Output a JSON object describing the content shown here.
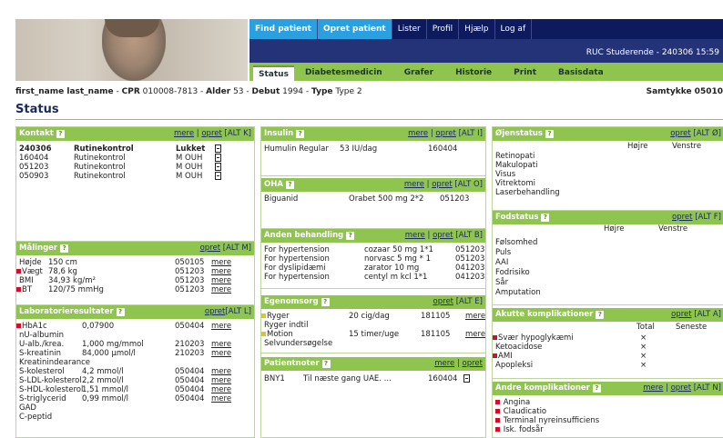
{
  "nav": {
    "find": "Find patient",
    "opret": "Opret patient",
    "lister": "Lister",
    "profil": "Profil",
    "hjaelp": "Hjælp",
    "logaf": "Log af"
  },
  "user": "RUC Studerende - 240306 15:59",
  "tabs": [
    "Status",
    "Diabetesmedicin",
    "Grafer",
    "Historie",
    "Print",
    "Basisdata"
  ],
  "patient": {
    "prefix": "first_name last_name",
    "cpr_label": "CPR",
    "cpr": "010008-7813",
    "alder_label": "Alder",
    "alder": "53",
    "debut_label": "Debut",
    "debut": "1994",
    "type_label": "Type",
    "type": "Type 2",
    "samtykke": "Samtykke 05010"
  },
  "page_title": "Status",
  "common": {
    "help": "?",
    "mere": "mere",
    "opret": "opret"
  },
  "kontakt": {
    "title": "Kontakt",
    "keys": "[ALT K]",
    "rows": [
      [
        "240306",
        "Rutinekontrol",
        "Lukket"
      ],
      [
        "160404",
        "Rutinekontrol",
        "M OUH"
      ],
      [
        "051203",
        "Rutinekontrol",
        "M OUH"
      ],
      [
        "050903",
        "Rutinekontrol",
        "M OUH"
      ]
    ]
  },
  "malinger": {
    "title": "Målinger",
    "keys": "[ALT M]",
    "rows": [
      [
        "Højde",
        "150 cm",
        "050105",
        ""
      ],
      [
        "Vægt",
        "78,6 kg",
        "051203",
        "red"
      ],
      [
        "BMI",
        "34,93 kg/m²",
        "051203",
        ""
      ],
      [
        "BT",
        "120/75 mmHg",
        "051203",
        "red"
      ]
    ]
  },
  "lab": {
    "title": "Laboratorieresultater",
    "keys": "[ALT L]",
    "rows": [
      [
        "HbA1c",
        "0,07900",
        "050404",
        "red"
      ],
      [
        "nU-albumin",
        "",
        "",
        ""
      ],
      [
        "U-alb./krea.",
        "1,000 mg/mmol",
        "210203",
        ""
      ],
      [
        "S-kreatinin",
        "84,000 µmol/l",
        "210203",
        ""
      ],
      [
        "Kreatinindearance",
        "",
        "",
        ""
      ],
      [
        "S-kolesterol",
        "4,2 mmol/l",
        "050404",
        ""
      ],
      [
        "S-LDL-kolesterol",
        "2,2 mmol/l",
        "050404",
        ""
      ],
      [
        "S-HDL-kolesterol",
        "1,51 mmol/l",
        "050404",
        ""
      ],
      [
        "S-triglycerid",
        "0,99 mmol/l",
        "050404",
        ""
      ],
      [
        "GAD",
        "",
        "",
        ""
      ],
      [
        "C-peptid",
        "",
        "",
        ""
      ]
    ]
  },
  "insulin": {
    "title": "Insulin",
    "keys": "[ALT I]",
    "rows": [
      [
        "Humulin Regular",
        "53 IU/dag",
        "160404"
      ]
    ]
  },
  "oha": {
    "title": "OHA",
    "keys": "[ALT O]",
    "rows": [
      [
        "Biguanid",
        "Orabet 500 mg 2*2",
        "051203"
      ]
    ]
  },
  "anden": {
    "title": "Anden behandling",
    "keys": "[ALT B]",
    "rows": [
      [
        "For hypertension",
        "cozaar 50 mg 1*1",
        "051203"
      ],
      [
        "For hypertension",
        "norvasc 5 mg * 1",
        "051203"
      ],
      [
        "For dyslipidæmi",
        "zarator 10 mg",
        "041203"
      ],
      [
        "For hypertension",
        "centyl m kcl 1*1",
        "041203"
      ]
    ]
  },
  "egen": {
    "title": "Egenomsorg",
    "keys": "[ALT E]",
    "rows": [
      [
        "Ryger",
        "20 cig/dag",
        "181105",
        "yel"
      ],
      [
        "Ryger indtil",
        "",
        "",
        ""
      ],
      [
        "Motion",
        "15 timer/uge",
        "181105",
        "yel"
      ],
      [
        "Selvundersøgelse",
        "",
        "",
        ""
      ]
    ]
  },
  "noter": {
    "title": "Patientnoter",
    "rows": [
      [
        "BNY1",
        "Til næste gang UAE. ...",
        "160404"
      ]
    ]
  },
  "ojen": {
    "title": "Øjenstatus",
    "keys": "[ALT Ø]",
    "hojre": "Højre",
    "venstre": "Venstre",
    "rows": [
      "Retinopati",
      "Makulopati",
      "Visus",
      "Vitrektomi",
      "Laserbehandling"
    ]
  },
  "fod": {
    "title": "Fodstatus",
    "keys": "[ALT F]",
    "hojre": "Højre",
    "venstre": "Venstre",
    "rows": [
      "Følsomhed",
      "Puls",
      "AAI",
      "Fodrisiko",
      "Sår",
      "Amputation"
    ]
  },
  "akutte": {
    "title": "Akutte komplikationer",
    "keys": "[ALT A]",
    "total": "Total",
    "seneste": "Seneste",
    "rows": [
      [
        "Svær hypoglykæmi",
        "×",
        "red"
      ],
      [
        "Ketoacidose",
        "×",
        ""
      ],
      [
        "AMI",
        "×",
        "red"
      ],
      [
        "Apopleksi",
        "×",
        ""
      ]
    ]
  },
  "andre": {
    "title": "Andre komplikationer",
    "keys": "[ALT N]",
    "rows": [
      "Angina",
      "Claudicatio",
      "Terminal nyreinsufficiens",
      "Isk. fodsår"
    ]
  },
  "colors": {
    "green": "#8fc44f",
    "navy": "#0d1a5e",
    "red": "#d0102a",
    "yellow": "#e8c020",
    "highlight": "#2aa0e0"
  }
}
